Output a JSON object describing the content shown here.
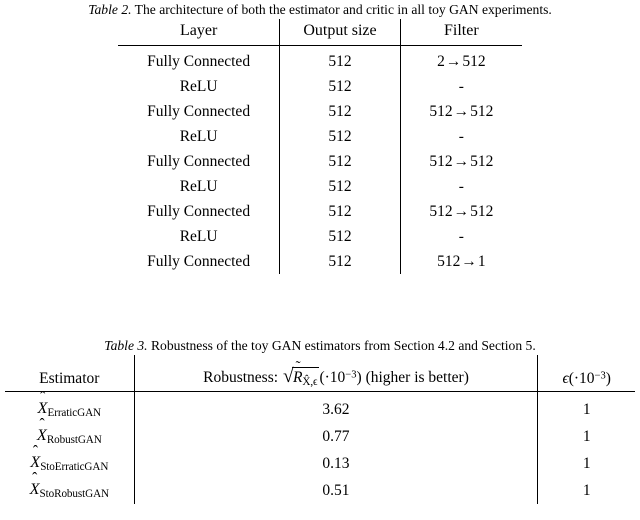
{
  "table2": {
    "caption_label": "Table 2.",
    "caption_text": "The architecture of both the estimator and critic in all toy GAN experiments.",
    "headers": [
      "Layer",
      "Output size",
      "Filter"
    ],
    "rows": [
      {
        "layer": "Fully Connected",
        "output": "512",
        "filter_from": "2",
        "filter_to": "512"
      },
      {
        "layer": "ReLU",
        "output": "512",
        "filter_from": "",
        "filter_to": "",
        "filter_plain": "-"
      },
      {
        "layer": "Fully Connected",
        "output": "512",
        "filter_from": "512",
        "filter_to": "512"
      },
      {
        "layer": "ReLU",
        "output": "512",
        "filter_from": "",
        "filter_to": "",
        "filter_plain": "-"
      },
      {
        "layer": "Fully Connected",
        "output": "512",
        "filter_from": "512",
        "filter_to": "512"
      },
      {
        "layer": "ReLU",
        "output": "512",
        "filter_from": "",
        "filter_to": "",
        "filter_plain": "-"
      },
      {
        "layer": "Fully Connected",
        "output": "512",
        "filter_from": "512",
        "filter_to": "512"
      },
      {
        "layer": "ReLU",
        "output": "512",
        "filter_from": "",
        "filter_to": "",
        "filter_plain": "-"
      },
      {
        "layer": "Fully Connected",
        "output": "512",
        "filter_from": "512",
        "filter_to": "1"
      }
    ]
  },
  "table3": {
    "caption_label": "Table 3.",
    "caption_text": "Robustness of the toy GAN estimators from Section 4.2 and Section 5.",
    "headers": {
      "estimator": "Estimator",
      "robustness_prefix": "Robustness:",
      "robustness_symbol": "R",
      "robustness_subscript": "X̂,ϵ",
      "robustness_scale_open": "(·10",
      "robustness_scale_exp": "−3",
      "robustness_scale_close": ")",
      "robustness_note": "(higher is better)",
      "epsilon_symbol": "ϵ",
      "epsilon_scale_open": "(·10",
      "epsilon_scale_exp": "−3",
      "epsilon_scale_close": ")"
    },
    "rows": [
      {
        "estimator_base": "X",
        "estimator_sub": "ErraticGAN",
        "robustness": "3.62",
        "epsilon": "1"
      },
      {
        "estimator_base": "X",
        "estimator_sub": "RobustGAN",
        "robustness": "0.77",
        "epsilon": "1"
      },
      {
        "estimator_base": "X",
        "estimator_sub": "StoErraticGAN",
        "robustness": "0.13",
        "epsilon": "1"
      },
      {
        "estimator_base": "X",
        "estimator_sub": "StoRobustGAN",
        "robustness": "0.51",
        "epsilon": "1"
      }
    ]
  },
  "symbols": {
    "arrow": "→",
    "radical": "√",
    "dash": "-"
  }
}
